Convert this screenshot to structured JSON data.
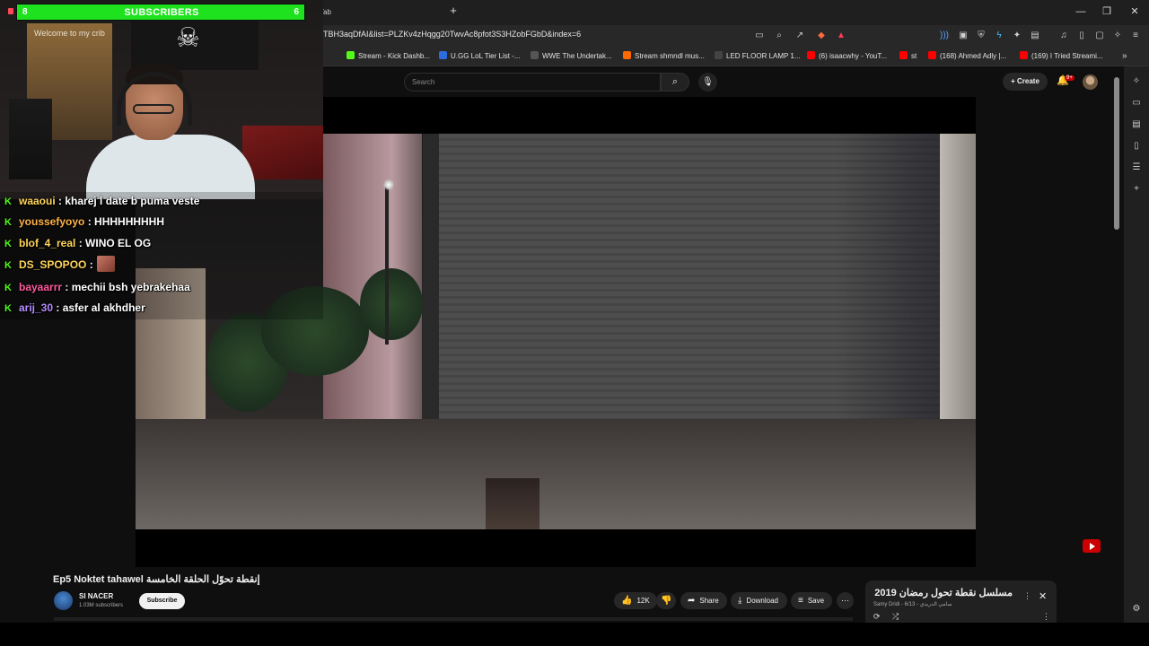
{
  "browser": {
    "tab_newtab": "New Tab",
    "url": "TBH3aqDfAI&list=PLZKv4zHqgg20TwvAc8pfot3S3HZobFGbD&index=6",
    "bookmarks": [
      {
        "label": "Stream - Kick Dashb...",
        "color": "#53fc18"
      },
      {
        "label": "U.GG LoL Tier List -...",
        "color": "#2d6cdf"
      },
      {
        "label": "WWE The Undertak...",
        "color": "#333333"
      },
      {
        "label": "Stream shmndl mus...",
        "color": "#ff6a00"
      },
      {
        "label": "LED FLOOR LAMP 1...",
        "color": "#555555"
      },
      {
        "label": "(6) isaacwhy - YouT...",
        "color": "#ff0000"
      },
      {
        "label": "st",
        "color": "#ff0000"
      },
      {
        "label": "(168) Ahmed Adly |...",
        "color": "#ff0000"
      },
      {
        "label": "(169) I Tried Streami...",
        "color": "#ff0000"
      }
    ]
  },
  "youtube": {
    "search_placeholder": "Search",
    "create_label": "Create",
    "notification_count": "9+"
  },
  "overlay": {
    "subs_left": "8",
    "subs_title": "SUBSCRIBERS",
    "subs_right": "6",
    "poster_text": "Welcome to my crib",
    "chat": [
      {
        "user": "waaoui",
        "message": " : kharej l date b puma veste",
        "color": "#ffd65a"
      },
      {
        "user": "youssefyoyo",
        "message": " : HHHHHHHHH",
        "color": "#ffb347"
      },
      {
        "user": "blof_4_real",
        "message": " : WINO EL OG",
        "color": "#ffd65a"
      },
      {
        "user": "DS_SPOPOO",
        "message": " :",
        "color": "#ffd65a"
      },
      {
        "user": "bayaarrr",
        "message": " : mechii bsh yebrakehaa",
        "color": "#ff5aa0"
      },
      {
        "user": "arij_30",
        "message": " : asfer al akhdher",
        "color": "#b48cff"
      }
    ]
  },
  "video": {
    "title": "Ep5 Noktet tahawel إنقطة تحوّل الحلقة الخامسة",
    "channel": "SI NACER",
    "subscribers": "1.03M subscribers",
    "subscribe_label": "Subscribe",
    "likes": "12K",
    "share_label": "Share",
    "download_label": "Download",
    "save_label": "Save"
  },
  "playlist": {
    "title": "مسلسل نقطة تحول رمضان 2019",
    "meta": "Samy Dridi - سامي الدريدي - 6/13"
  }
}
